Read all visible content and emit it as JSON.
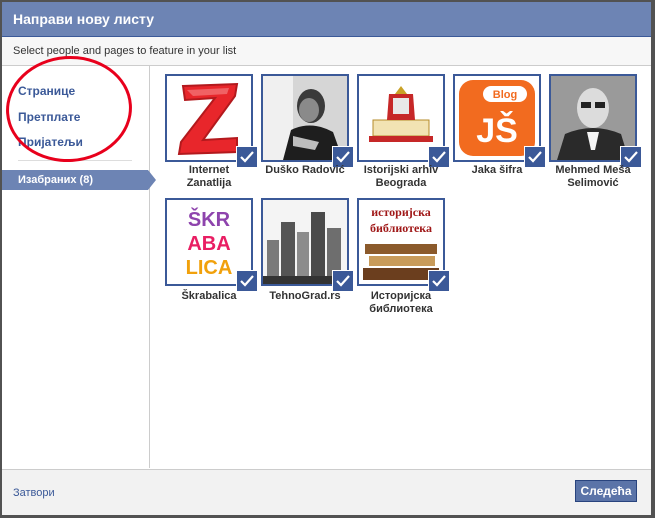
{
  "dialog": {
    "title": "Направи нову листу",
    "subtitle": "Select people and pages to feature in your list"
  },
  "sidebar": {
    "items": [
      {
        "label": "Странице"
      },
      {
        "label": "Претплате"
      },
      {
        "label": "Пријатељи"
      }
    ],
    "selected": {
      "label": "Изабраних (8)"
    }
  },
  "tiles": [
    {
      "name": "Internet Zanatlija",
      "line1": "Internet",
      "line2": "Zanatlija"
    },
    {
      "name": "Duško Radović",
      "line1": "Duško Radović",
      "line2": ""
    },
    {
      "name": "Istorijski arhiv Beograda",
      "line1": "Istorijski arhiv",
      "line2": "Beograda"
    },
    {
      "name": "Jaka šifra",
      "line1": "Jaka šifra",
      "line2": ""
    },
    {
      "name": "Mehmed Meša Selimović",
      "line1": "Mehmed Meša",
      "line2": "Selimović"
    },
    {
      "name": "Škrabalica",
      "line1": "Škrabalica",
      "line2": ""
    },
    {
      "name": "TehnoGrad.rs",
      "line1": "TehnoGrad.rs",
      "line2": ""
    },
    {
      "name": "Историјска библиотека",
      "line1": "Историјска",
      "line2": "библиотека"
    }
  ],
  "logos": {
    "jaka_sifra": {
      "blog": "Blog",
      "js": "JŠ"
    },
    "skrabalica": {
      "row1": "ŠKR",
      "row2": "ABA",
      "row3": "LICA"
    },
    "istorijska": {
      "line1": "историјска",
      "line2": "библиотека"
    }
  },
  "footer": {
    "close_label": "Затвори",
    "next_label": "Следећа"
  },
  "colors": {
    "header": "#6d84b4",
    "link": "#3b5998",
    "annotation": "#e8001c"
  }
}
